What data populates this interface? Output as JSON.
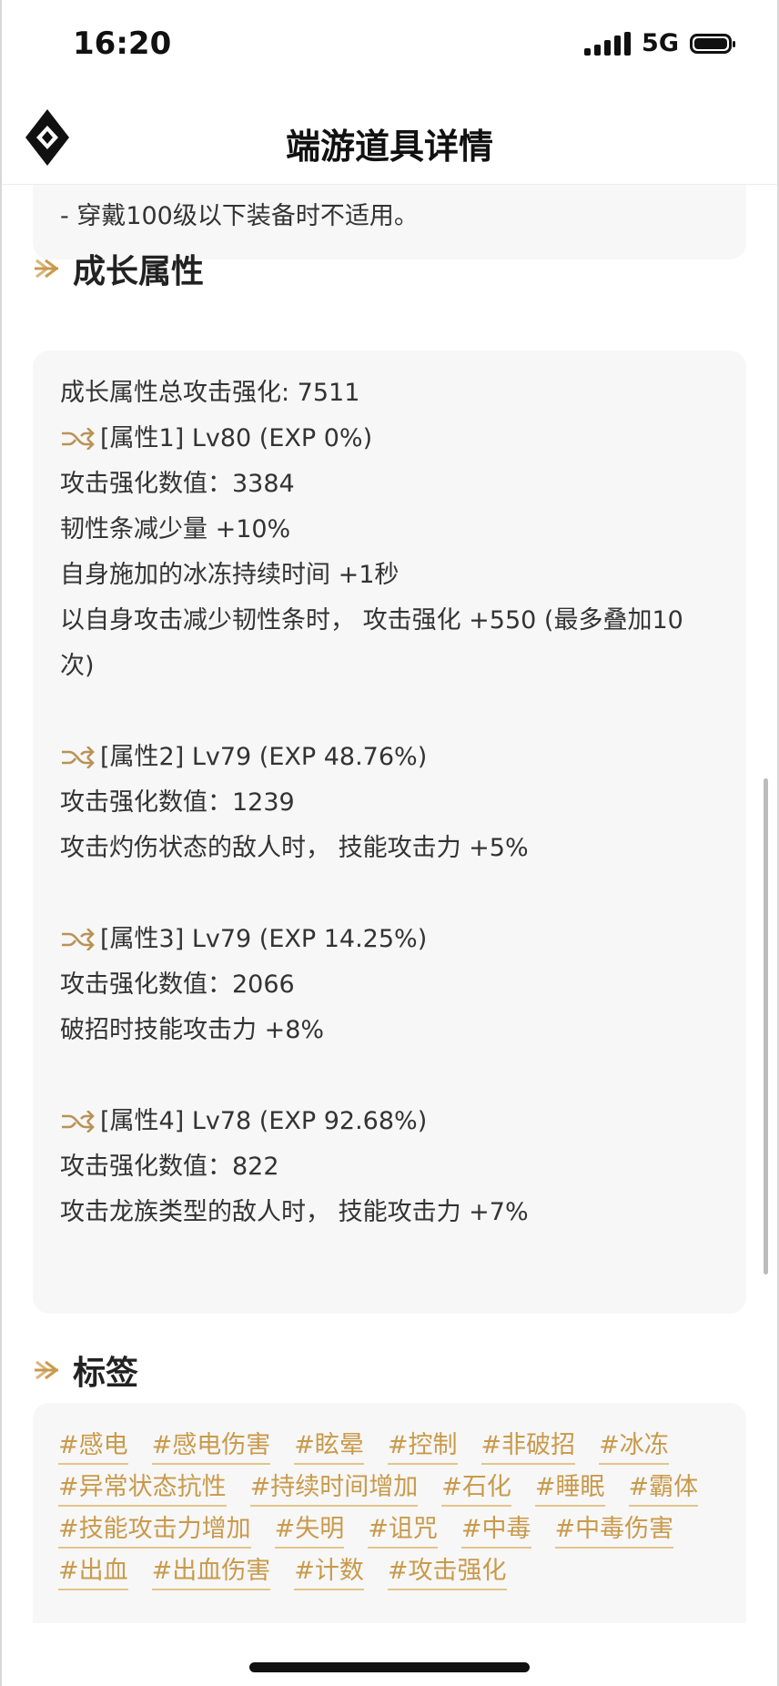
{
  "status_bar": {
    "time": "16:20",
    "network": "5G"
  },
  "nav": {
    "title": "端游道具详情"
  },
  "note": {
    "text": "- 穿戴100级以下装备时不适用。"
  },
  "growth": {
    "title": "成长属性",
    "lines": {
      "total": "成长属性总攻击强化: 7511",
      "a1_head": "[属性1] Lv80 (EXP 0%)",
      "a1_l1": "攻击强化数值：3384",
      "a1_l2": "韧性条减少量 +10%",
      "a1_l3": "自身施加的冰冻持续时间 +1秒",
      "a1_l4a": "以自身攻击减少韧性条时， 攻击强化 +550 (最多叠加10",
      "a1_l4b": "次)",
      "a2_head": "[属性2] Lv79 (EXP 48.76%)",
      "a2_l1": "攻击强化数值：1239",
      "a2_l2": "攻击灼伤状态的敌人时， 技能攻击力 +5%",
      "a3_head": "[属性3] Lv79 (EXP 14.25%)",
      "a3_l1": "攻击强化数值：2066",
      "a3_l2": "破招时技能攻击力 +8%",
      "a4_head": "[属性4] Lv78 (EXP 92.68%)",
      "a4_l1": "攻击强化数值：822",
      "a4_l2": "攻击龙族类型的敌人时， 技能攻击力 +7%"
    }
  },
  "tags": {
    "title": "标签",
    "items": [
      "#感电",
      "#感电伤害",
      "#眩晕",
      "#控制",
      "#非破招",
      "#冰冻",
      "#异常状态抗性",
      "#持续时间增加",
      "#石化",
      "#睡眠",
      "#霸体",
      "#技能攻击力增加",
      "#失明",
      "#诅咒",
      "#中毒",
      "#中毒伤害",
      "#出血",
      "#出血伤害",
      "#计数",
      "#攻击强化"
    ]
  },
  "colors": {
    "accent": "#c99a4b",
    "card_bg": "#f7f7f7",
    "text": "#333333"
  },
  "icons": [
    "diamond-logo-icon",
    "arrow-section-icon",
    "shuffle-icon"
  ]
}
